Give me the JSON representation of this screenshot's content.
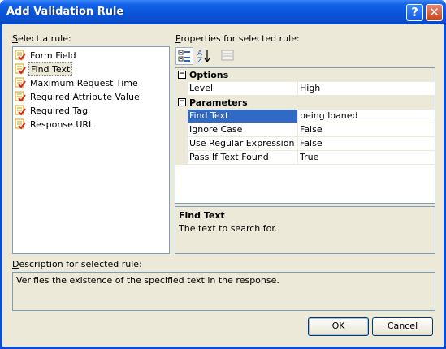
{
  "window": {
    "title": "Add Validation Rule",
    "help_glyph": "?",
    "close_glyph": "✕"
  },
  "rules": {
    "label": "Select a rule:",
    "items": [
      {
        "label": "Form Field",
        "icon": "validation-rule-icon"
      },
      {
        "label": "Find Text",
        "icon": "validation-rule-icon",
        "selected": true
      },
      {
        "label": "Maximum Request Time",
        "icon": "validation-rule-icon"
      },
      {
        "label": "Required Attribute Value",
        "icon": "validation-rule-icon"
      },
      {
        "label": "Required Tag",
        "icon": "validation-rule-icon"
      },
      {
        "label": "Response URL",
        "icon": "validation-rule-icon"
      }
    ]
  },
  "properties": {
    "label": "Properties for selected rule:",
    "toolbar": [
      "categorized-icon",
      "alphabetical-sort-icon",
      "property-pages-icon"
    ],
    "grid": {
      "categories": [
        {
          "name": "Options",
          "expanded": true,
          "rows": [
            {
              "name": "Level",
              "value": "High"
            }
          ]
        },
        {
          "name": "Parameters",
          "expanded": true,
          "rows": [
            {
              "name": "Find Text",
              "value": "being loaned",
              "selected": true
            },
            {
              "name": "Ignore Case",
              "value": "False"
            },
            {
              "name": "Use Regular Expression",
              "value": "False"
            },
            {
              "name": "Pass If Text Found",
              "value": "True"
            }
          ]
        }
      ]
    },
    "help": {
      "title": "Find Text",
      "text": "The text to search for."
    }
  },
  "description": {
    "label": "Description for selected rule:",
    "text": "Verifies the existence of the specified text in the response."
  },
  "buttons": {
    "ok": "OK",
    "cancel": "Cancel"
  }
}
